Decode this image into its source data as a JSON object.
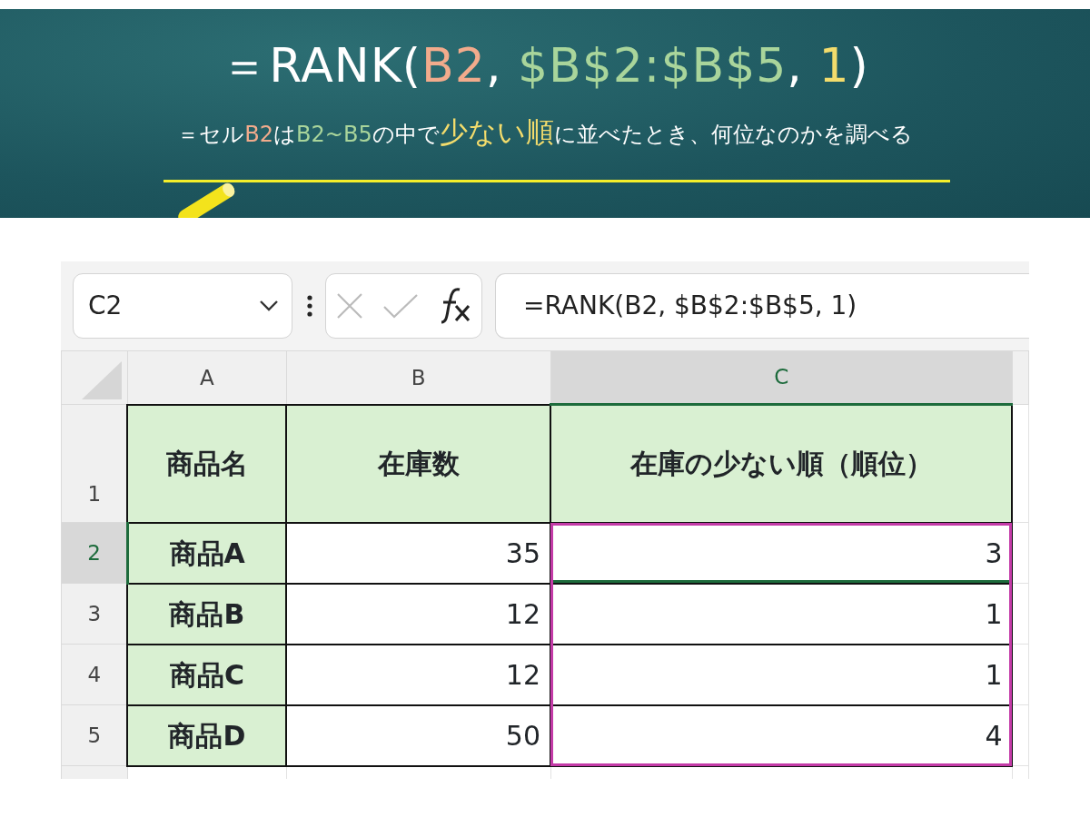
{
  "banner": {
    "formula": [
      {
        "text": "＝RANK(",
        "color": "#ffffff"
      },
      {
        "text": "B2",
        "color": "#f2ab8c"
      },
      {
        "text": ", ",
        "color": "#ffffff"
      },
      {
        "text": "$B$2:$B$5",
        "color": "#a9d59b"
      },
      {
        "text": ", ",
        "color": "#ffffff"
      },
      {
        "text": "1",
        "color": "#f3dc6c"
      },
      {
        "text": ")",
        "color": "#ffffff"
      }
    ],
    "explanation": [
      {
        "text": "＝セル",
        "color": "#ffffff",
        "kind": "normal"
      },
      {
        "text": "B2",
        "color": "#f2ab8c",
        "kind": "normal"
      },
      {
        "text": "は",
        "color": "#ffffff",
        "kind": "normal"
      },
      {
        "text": "B2~B5",
        "color": "#a9d59b",
        "kind": "normal"
      },
      {
        "text": "の中で",
        "color": "#ffffff",
        "kind": "normal"
      },
      {
        "text": "少ない順",
        "color": "#f3dc6c",
        "kind": "highlight"
      },
      {
        "text": "に並べたとき、何位なのかを調べる",
        "color": "#ffffff",
        "kind": "normal"
      }
    ]
  },
  "spreadsheet": {
    "name_box": "C2",
    "formula": "=RANK(B2, $B$2:$B$5, 1)",
    "columns": [
      {
        "label": "A",
        "selected": false,
        "highlighted": false
      },
      {
        "label": "B",
        "selected": false,
        "highlighted": false
      },
      {
        "label": "C",
        "selected": true,
        "highlighted": true
      }
    ],
    "highlight": {
      "color": "#c43ba8"
    },
    "rows": [
      {
        "number": "1",
        "selected": false,
        "kind": "header",
        "cells": [
          "商品名",
          "在庫数",
          "在庫の少ない順（順位）"
        ]
      },
      {
        "number": "2",
        "selected": true,
        "kind": "data",
        "cells": [
          "商品A",
          "35",
          "3"
        ]
      },
      {
        "number": "3",
        "selected": false,
        "kind": "data",
        "cells": [
          "商品B",
          "12",
          "1"
        ]
      },
      {
        "number": "4",
        "selected": false,
        "kind": "data",
        "cells": [
          "商品C",
          "12",
          "1"
        ]
      },
      {
        "number": "5",
        "selected": false,
        "kind": "data",
        "cells": [
          "商品D",
          "50",
          "4"
        ]
      }
    ]
  }
}
